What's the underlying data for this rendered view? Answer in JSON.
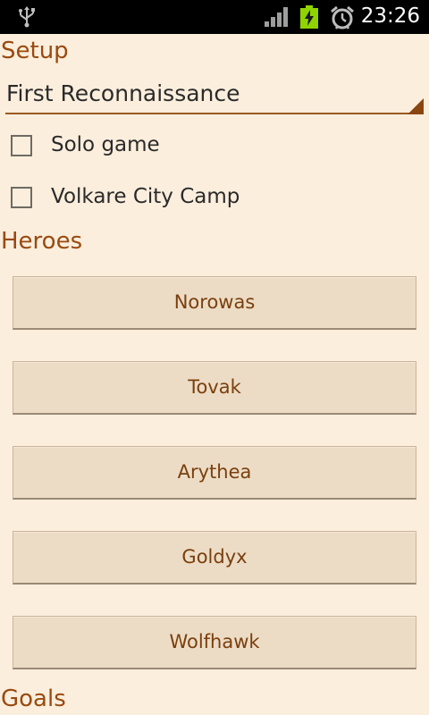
{
  "status_bar": {
    "time": "23:26",
    "icons": [
      "usb-icon",
      "signal-icon",
      "battery-charging-icon",
      "alarm-icon"
    ]
  },
  "setup": {
    "header": "Setup",
    "scenario_selected": "First Reconnaissance",
    "options": [
      {
        "label": "Solo game",
        "checked": false
      },
      {
        "label": "Volkare City Camp",
        "checked": false
      }
    ]
  },
  "heroes": {
    "header": "Heroes",
    "items": [
      "Norowas",
      "Tovak",
      "Arythea",
      "Goldyx",
      "Wolfhawk"
    ]
  },
  "goals": {
    "header": "Goals"
  },
  "colors": {
    "background": "#fbeedd",
    "header": "#9a4a10",
    "button": "#ecdcc5",
    "button_text": "#7a3f0e"
  }
}
